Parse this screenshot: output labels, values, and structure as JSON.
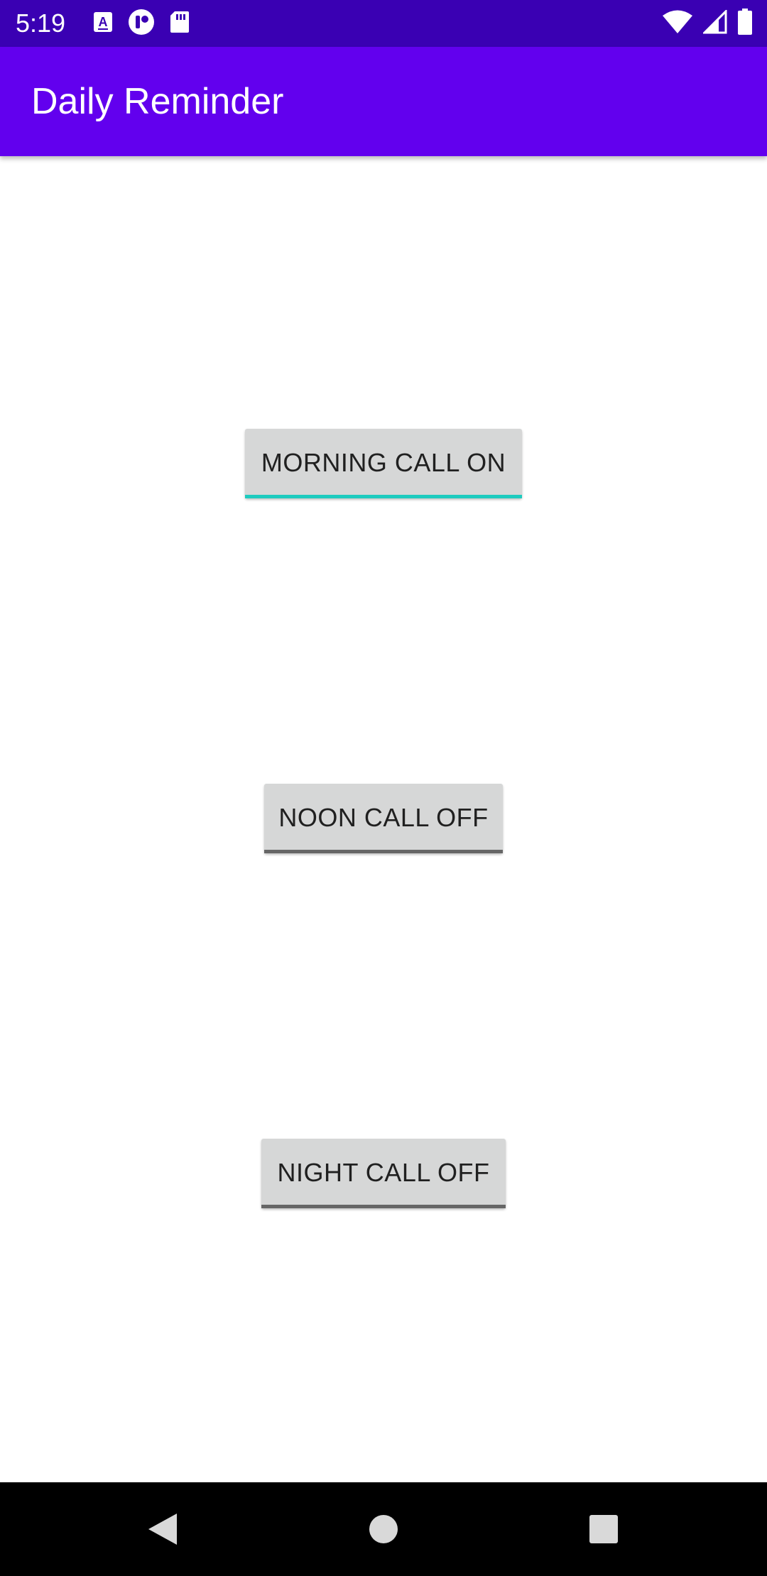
{
  "status_bar": {
    "time": "5:19",
    "background": "#3a00b3",
    "left_icons": [
      "keyboard-a-icon",
      "notification-app-icon",
      "sd-card-icon"
    ],
    "right_icons": [
      "wifi-icon",
      "cell-signal-icon",
      "battery-icon"
    ]
  },
  "app_bar": {
    "title": "Daily Reminder",
    "background": "#6200ee"
  },
  "buttons": {
    "morning": {
      "label": "MORNING CALL ON",
      "state": "on",
      "underline_color": "#1ecbbf"
    },
    "noon": {
      "label": "NOON CALL OFF",
      "state": "off",
      "underline_color": "#666666"
    },
    "night": {
      "label": "NIGHT CALL OFF",
      "state": "off",
      "underline_color": "#666666"
    }
  },
  "nav_bar": {
    "icons": [
      "back-icon",
      "home-icon",
      "recents-icon"
    ]
  }
}
